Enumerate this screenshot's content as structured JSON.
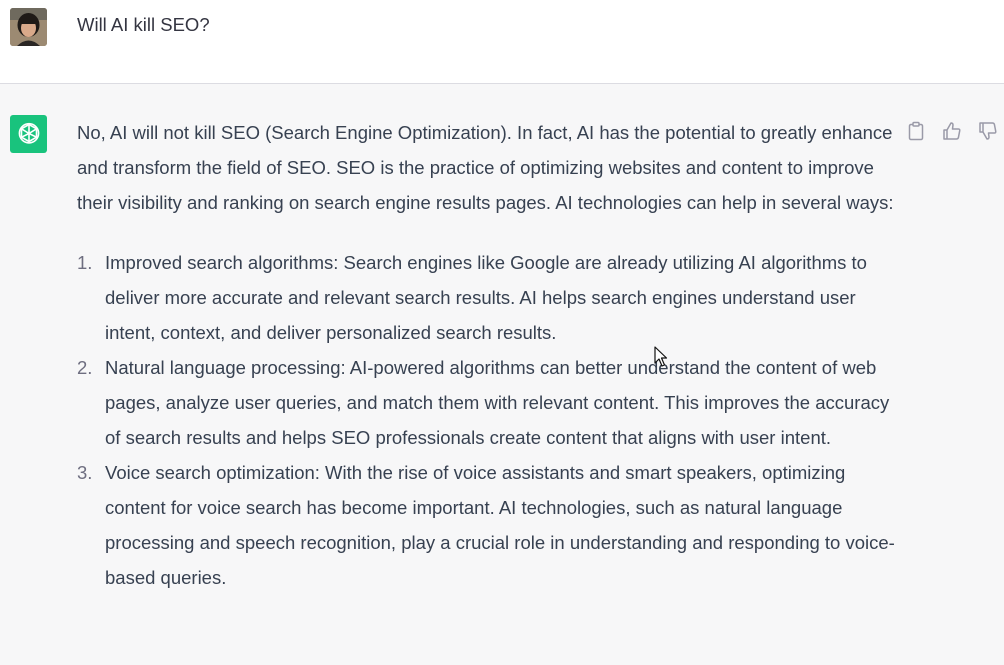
{
  "user": {
    "avatar_icon": "user-avatar-photo",
    "message": "Will AI kill SEO?"
  },
  "assistant": {
    "avatar_icon": "openai-logo-icon",
    "avatar_color": "#19c37d",
    "intro": "No, AI will not kill SEO (Search Engine Optimization). In fact, AI has the potential to greatly enhance and transform the field of SEO. SEO is the practice of optimizing websites and content to improve their visibility and ranking on search engine results pages. AI technologies can help in several ways:",
    "items": [
      {
        "number": "1.",
        "text": "Improved search algorithms: Search engines like Google are already utilizing AI algorithms to deliver more accurate and relevant search results. AI helps search engines understand user intent, context, and deliver personalized search results."
      },
      {
        "number": "2.",
        "text": "Natural language processing: AI-powered algorithms can better understand the content of web pages, analyze user queries, and match them with relevant content. This improves the accuracy of search results and helps SEO professionals create content that aligns with user intent."
      },
      {
        "number": "3.",
        "text": "Voice search optimization: With the rise of voice assistants and smart speakers, optimizing content for voice search has become important. AI technologies, such as natural language processing and speech recognition, play a crucial role in understanding and responding to voice-based queries."
      }
    ],
    "actions": [
      "copy-icon",
      "thumbs-up-icon",
      "thumbs-down-icon"
    ]
  }
}
